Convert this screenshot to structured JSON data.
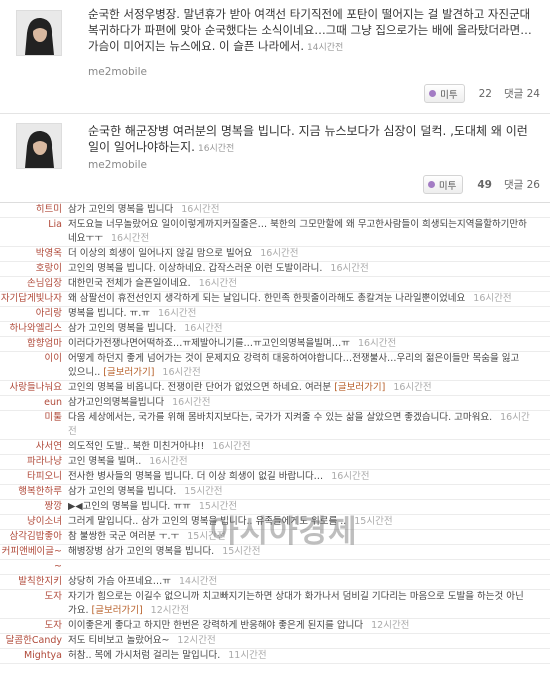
{
  "posts": [
    {
      "text": "순국한 서정우병장. 말년휴가 받아 여객선 타기직전에 포탄이 떨어지는 걸 발견하고 자진군대복귀하다가 파편에 맞아 순국했다는 소식이네요…그때 그냥 집으로가는 배에 올라탔더라면… 가슴이 미어지는 뉴스에요. 이 슬픈 나라에서.",
      "time": "14시간전",
      "source": "me2mobile",
      "metoo_label": "미투",
      "metoo_count": "22",
      "reply_label": "댓글 24"
    },
    {
      "text": "순국한 해군장병 여러분의 명복을 빕니다. 지금 뉴스보다가 심장이 덜컥. ,도대체 왜 이런일이 일어나야하는지.",
      "time": "16시간전",
      "source": "me2mobile",
      "metoo_label": "미투",
      "metoo_count": "49",
      "reply_label": "댓글 26"
    }
  ],
  "comments": [
    {
      "name": "히트미",
      "text": "삼가 고인의 명복을 빕니다",
      "link": "",
      "time": "16시간전"
    },
    {
      "name": "Lia",
      "text": "저도요늘 너무놀랐어요 일이이렇게까지커질줄은… 북한의 그모만할에 왜 무고한사람들이 희생되는지역을할하기만하네요ㅜㅜ",
      "link": "",
      "time": "16시간전"
    },
    {
      "name": "박영옥",
      "text": "더 이상의 희생이 일어나지 않길 맘으로 빌어요",
      "link": "",
      "time": "16시간전"
    },
    {
      "name": "호랑이",
      "text": "고인의 명복을 빕니다. 이상하네요. 갑작스러운 이런 도발이라니.",
      "link": "",
      "time": "16시간전"
    },
    {
      "name": "손님입장",
      "text": "대한민국 전체가 슬픈일이네요.",
      "link": "",
      "time": "16시간전"
    },
    {
      "name": "자기답게빛나자",
      "text": "왜 삼팔선이 휴전선인지 생각하게 되는 날입니다. 한민족 한핏줄이라해도 총칼겨눈 나라일뿐이었네요",
      "link": "",
      "time": "16시간전"
    },
    {
      "name": "아리랑",
      "text": "명복을 빕니다. ㅠ.ㅠ",
      "link": "",
      "time": "16시간전"
    },
    {
      "name": "하나와엘리스",
      "text": "삼가 고인의 명복을 빕니다.",
      "link": "",
      "time": "16시간전"
    },
    {
      "name": "함향엄마",
      "text": "이러다가전쟁나면어떡하죠…ㅠ제발아니기를…ㅠ고인의명복을빌며…ㅠ",
      "link": "",
      "time": "16시간전"
    },
    {
      "name": "이이",
      "text": "어떻게 하던지 좋게 넘어가는 것이 문제지요 강력히 대응하여야합니다…전쟁불사…우리의 젊은이들만 목숨을 잃고 있으니..",
      "link": "[글보러가기]",
      "time": "16시간전"
    },
    {
      "name": "사랑들나눠요",
      "text": "고인의 명복을 비옵니다. 전쟁이란 단어가 없었으면 하네요. 여러분",
      "link": "[글보러가기]",
      "time": "16시간전"
    },
    {
      "name": "eun",
      "text": "삼가고인의명복을빕니다",
      "link": "",
      "time": "16시간전"
    },
    {
      "name": "미툴",
      "text": "다음 세상에서는, 국가를 위해 몸바치지보다는, 국가가 지켜줄 수 있는 삶을 살았으면 좋겠습니다. 고마워요.",
      "link": "",
      "time": "16시간전"
    },
    {
      "name": "사서연",
      "text": "의도적인 도발.. 북한 미친거아냐!!",
      "link": "",
      "time": "16시간전"
    },
    {
      "name": "파라나냥",
      "text": "고인 명복을 빌며..",
      "link": "",
      "time": "16시간전"
    },
    {
      "name": "타피오니",
      "text": "전사한 병사들의 명복을 빕니다. 더 이상 희생이 없길 바랍니다…",
      "link": "",
      "time": "16시간전"
    },
    {
      "name": "행복한하루",
      "text": "삼가 고인의 명복을 빕니다.",
      "link": "",
      "time": "15시간전"
    },
    {
      "name": "짱깡",
      "text": "▶◀고인의 명복을 빕니다. ㅠㅠ",
      "link": "",
      "time": "15시간전"
    },
    {
      "name": "냥이소녀",
      "text": "그러게 말입니다.. 삼가 고인의 명복을 빕니다.. 유족들에게도 위로를 ..",
      "link": "",
      "time": "15시간전"
    },
    {
      "name": "삼각김밥좋아",
      "text": "참 불쌍한 국군 여러분 ㅜ.ㅜ",
      "link": "",
      "time": "15시간전"
    },
    {
      "name": "커피앤베이글~",
      "text": "해병장병 삼가 고인의 명복을 빕니다.",
      "link": "",
      "time": "15시간전"
    },
    {
      "name": "~",
      "text": "",
      "link": "",
      "time": ""
    },
    {
      "name": "발칙한지키",
      "text": "상당히 가슴 아프네요…ㅠ",
      "link": "",
      "time": "14시간전"
    },
    {
      "name": "도자",
      "text": "자기가 힘으로는 이길수 없으니까 치고빠지기는하면 상대가 화가나서 덤비길 기다리는 마음으로 도발을 하는것 아닌가요.",
      "link": "[글보러가기]",
      "time": "12시간전"
    },
    {
      "name": "도자",
      "text": "이이좋은게 좋다고 하지만 한번은 강력하게 반응해야 좋은게 된지를 압니다",
      "link": "",
      "time": "12시간전"
    },
    {
      "name": "달콤한Candy",
      "text": "저도 티비보고 놀랐어요~",
      "link": "",
      "time": "12시간전"
    },
    {
      "name": "Mightya",
      "text": "허참.. 목에 가시처럼 걸리는 말입니다.",
      "link": "",
      "time": "11시간전"
    }
  ],
  "watermark": "아시아경제",
  "colors": {
    "name": "#b04a3a",
    "link": "#b7602a",
    "metoo_dot": "#a37cc4"
  }
}
